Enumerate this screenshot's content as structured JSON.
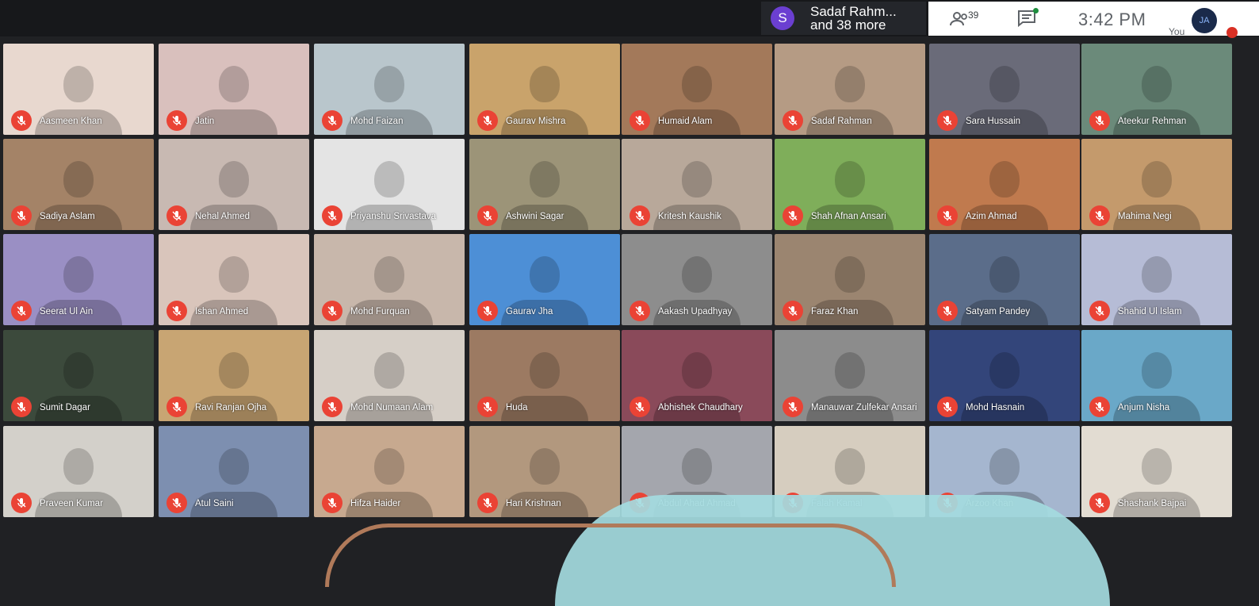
{
  "presenter": {
    "avatar_letter": "S",
    "line1": "Sadaf Rahm...",
    "line2": "and 38 more"
  },
  "controls": {
    "people_count": "39",
    "time": "3:42 PM",
    "you_label": "You",
    "self_initials": "JA"
  },
  "participants": [
    {
      "name": "Aasmeen Khan",
      "color": "#e8d8cf"
    },
    {
      "name": "Jatin",
      "color": "#d9c0bd"
    },
    {
      "name": "Mohd Faizan",
      "color": "#b9c6cc"
    },
    {
      "name": "Gaurav Mishra",
      "color": "#c9a36b"
    },
    {
      "name": "Humaid Alam",
      "color": "#a3795a"
    },
    {
      "name": "Sadaf Rahman",
      "color": "#b59b84"
    },
    {
      "name": "Sara Hussain",
      "color": "#6a6b79"
    },
    {
      "name": "Ateekur Rehman",
      "color": "#6b8a7a"
    },
    {
      "name": "Sadiya Aslam",
      "color": "#a48367"
    },
    {
      "name": "Nehal Ahmed",
      "color": "#c8b9b2"
    },
    {
      "name": "Priyanshu Srivastava",
      "color": "#e4e4e4"
    },
    {
      "name": "Ashwini Sagar",
      "color": "#9c9478"
    },
    {
      "name": "Kritesh Kaushik",
      "color": "#b8a89a"
    },
    {
      "name": "Shah Afnan Ansari",
      "color": "#7fae5a"
    },
    {
      "name": "Azim Ahmad",
      "color": "#c07a4e"
    },
    {
      "name": "Mahima Negi",
      "color": "#c49a6c"
    },
    {
      "name": "Seerat Ul Ain",
      "color": "#9a8fc4"
    },
    {
      "name": "Ishan Ahmed",
      "color": "#d9c5bb"
    },
    {
      "name": "Mohd Furquan",
      "color": "#c8b7ab"
    },
    {
      "name": "Gaurav Jha",
      "color": "#4d8fd6"
    },
    {
      "name": "Aakash Upadhyay",
      "color": "#8d8d8d"
    },
    {
      "name": "Faraz Khan",
      "color": "#9b8570"
    },
    {
      "name": "Satyam Pandey",
      "color": "#5b6d8a"
    },
    {
      "name": "Shahid Ul Islam",
      "color": "#b6bcd6"
    },
    {
      "name": "Sumit Dagar",
      "color": "#3c4a3c"
    },
    {
      "name": "Ravi Ranjan Ojha",
      "color": "#c8a573"
    },
    {
      "name": "Mohd Numaan Alam",
      "color": "#d6cfc7"
    },
    {
      "name": "Huda",
      "color": "#9c7a62"
    },
    {
      "name": "Abhishek Chaudhary",
      "color": "#8a4a5a"
    },
    {
      "name": "Manauwar Zulfekar Ansari",
      "color": "#8c8c8c"
    },
    {
      "name": "Mohd Hasnain",
      "color": "#33457a"
    },
    {
      "name": "Anjum Nisha",
      "color": "#6aa8c8"
    },
    {
      "name": "Praveen Kumar",
      "color": "#d3d0ca"
    },
    {
      "name": "Atul Saini",
      "color": "#7d8fb0"
    },
    {
      "name": "Hifza Haider",
      "color": "#c7a98f"
    },
    {
      "name": "Hari Krishnan",
      "color": "#b2987e"
    },
    {
      "name": "Abdul Ahad Ahmad",
      "color": "#a4a6ad"
    },
    {
      "name": "Falah Kamal",
      "color": "#d6cdbf"
    },
    {
      "name": "Arzoo Khan",
      "color": "#a5b6cf"
    },
    {
      "name": "Shashank Bajpai",
      "color": "#e2dcd2"
    }
  ]
}
